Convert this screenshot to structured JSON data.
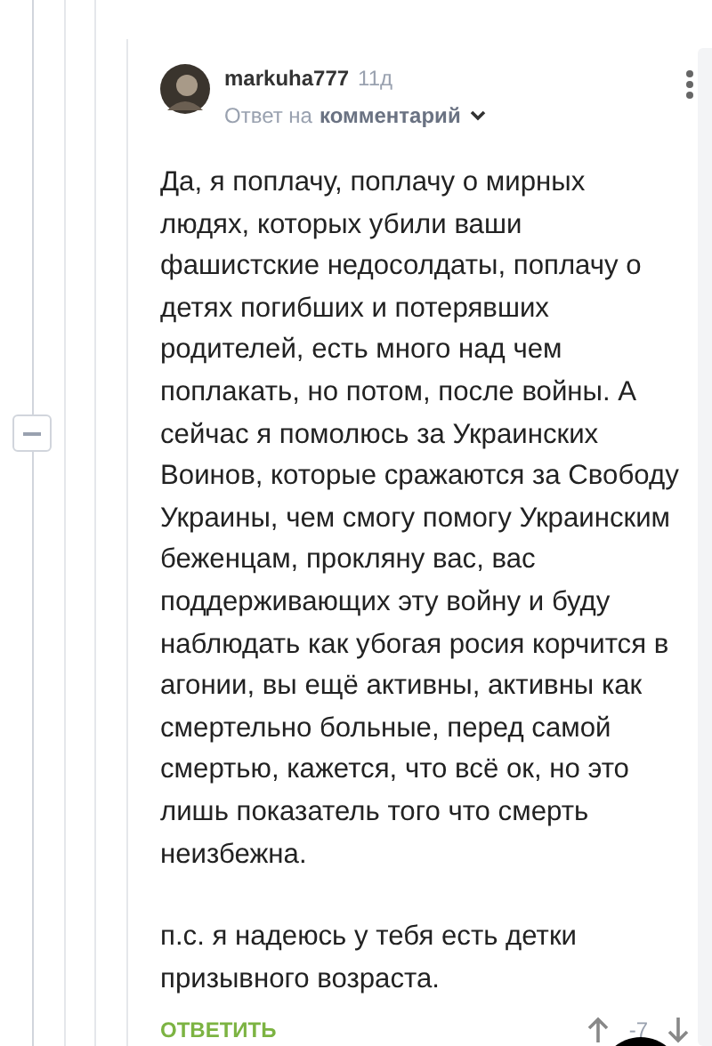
{
  "comment": {
    "author": "markuha777",
    "time": "11д",
    "reply_prefix": "Ответ на",
    "reply_target": "комментарий",
    "paragraphs": [
      "Да, я поплачу, поплачу о мирных людях, которых убили ваши фашистские недосолдаты, поплачу о детях погибших и потерявших родителей, есть много над чем поплакать, но потом, после войны. А сейчас я помолюсь за Украинских Воинов, которые сражаются за Свободу Украины, чем смогу помогу Украинским беженцам, прокляну вас, вас поддерживающих эту войну и буду наблюдать как убогая росия корчится в агонии, вы ещё активны, активны как смертельно больные, перед самой смертью, кажется, что всё ок, но это лишь показатель того что смерть неизбежна.",
      "п.с. я надеюсь у тебя есть детки призывного возраста."
    ],
    "reply_button": "ОТВЕТИТЬ",
    "rating": "-7"
  }
}
